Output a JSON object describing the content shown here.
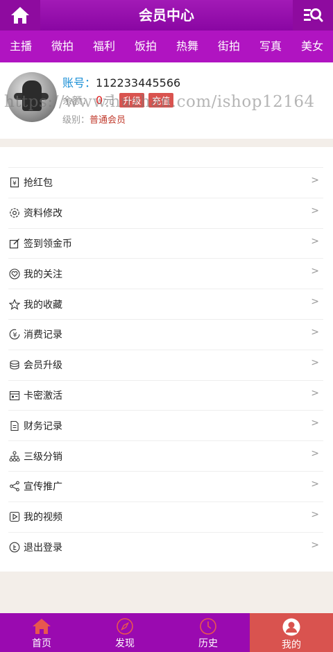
{
  "header": {
    "title": "会员中心"
  },
  "categories": [
    "主播",
    "微拍",
    "福利",
    "饭拍",
    "热舞",
    "街拍",
    "写真",
    "美女"
  ],
  "profile": {
    "account_label": "账号：",
    "account_value": "112233445566",
    "balance_label": "余额：",
    "balance_value": "0",
    "balance_unit": "元",
    "upgrade_label": "升级",
    "recharge_label": "充值",
    "level_label": "级别：",
    "level_value": "普通会员"
  },
  "watermark": "https://www.huzhan.com/ishop12164",
  "menu": [
    {
      "label": "抢红包",
      "icon": "red-envelope-icon"
    },
    {
      "label": "资料修改",
      "icon": "gear-icon"
    },
    {
      "label": "签到领金币",
      "icon": "edit-icon"
    },
    {
      "label": "我的关注",
      "icon": "heart-icon"
    },
    {
      "label": "我的收藏",
      "icon": "star-icon"
    },
    {
      "label": "消费记录",
      "icon": "yuan-icon"
    },
    {
      "label": "会员升级",
      "icon": "coins-icon"
    },
    {
      "label": "卡密激活",
      "icon": "card-icon"
    },
    {
      "label": "财务记录",
      "icon": "document-icon"
    },
    {
      "label": "三级分销",
      "icon": "network-icon"
    },
    {
      "label": "宣传推广",
      "icon": "share-icon"
    },
    {
      "label": "我的视频",
      "icon": "video-icon"
    },
    {
      "label": "退出登录",
      "icon": "logout-icon"
    }
  ],
  "menu_arrow": ">",
  "bottom_nav": [
    {
      "label": "首页",
      "icon": "home-icon"
    },
    {
      "label": "发现",
      "icon": "compass-icon"
    },
    {
      "label": "历史",
      "icon": "clock-icon"
    },
    {
      "label": "我的",
      "icon": "user-icon"
    }
  ],
  "colors": {
    "header": "#9a0ab0",
    "category_bar": "#b014c1",
    "bottom_nav": "#9a0ab0",
    "active_tab": "#d9534f",
    "account_label": "#1a8fd6",
    "level_value": "#c0392b"
  }
}
